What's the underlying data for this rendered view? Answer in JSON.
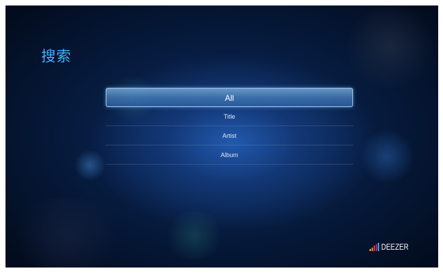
{
  "title": "搜索",
  "search_menu": {
    "items": [
      {
        "label": "All",
        "selected": true
      },
      {
        "label": "Title",
        "selected": false
      },
      {
        "label": "Artist",
        "selected": false
      },
      {
        "label": "Album",
        "selected": false
      }
    ]
  },
  "brand": {
    "name": "DEEZER",
    "icon": "equalizer-bars-icon",
    "bar_colors": [
      "#f5b51b",
      "#f08a1d",
      "#e5334e",
      "#c0207c",
      "#2fa8e0"
    ]
  },
  "colors": {
    "title": "#3fb3ff",
    "selection": "#5a8fc8"
  }
}
